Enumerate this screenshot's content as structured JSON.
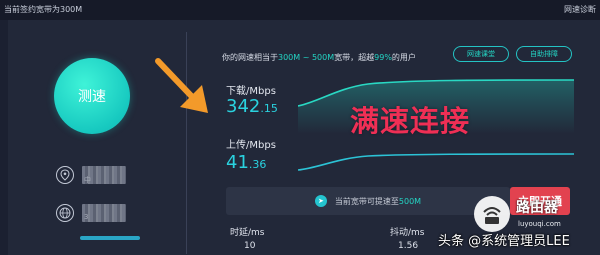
{
  "topbar": {
    "left_text": "当前签约宽带为300M",
    "right_text": "网速诊断"
  },
  "speed_test_button": {
    "label": "测速"
  },
  "info": {
    "location_text": "中",
    "ip_text": "3"
  },
  "result": {
    "headline_prefix": "你的网速相当于",
    "headline_range": "300M ~ 500M",
    "headline_mid": "宽带，超越",
    "headline_percent": "99%",
    "headline_suffix": "的用户",
    "btn_course": "网速课堂",
    "btn_troubleshoot": "自助排障"
  },
  "download": {
    "label": "下载/Mbps",
    "value_int": "342",
    "value_dec": ".15"
  },
  "upload": {
    "label": "上传/Mbps",
    "value_int": "41",
    "value_dec": ".36"
  },
  "overlay": {
    "text": "满速连接"
  },
  "upgrade": {
    "text_prefix": "当前宽带可提速至",
    "text_value": "500M",
    "button_label": "立即开通"
  },
  "stats": {
    "latency_label": "时延/ms",
    "latency_value": "10",
    "jitter_label": "抖动/ms",
    "jitter_value": "1.56"
  },
  "watermark": {
    "brand": "路由器",
    "url": "luyouqi.com",
    "credit": "头条 @系统管理员LEE"
  },
  "colors": {
    "accent": "#24d5c4",
    "speed_value": "#2ad2df",
    "overlay_red": "#ef2f55",
    "button_red": "#e2424f",
    "arrow_orange": "#f39a2a"
  }
}
